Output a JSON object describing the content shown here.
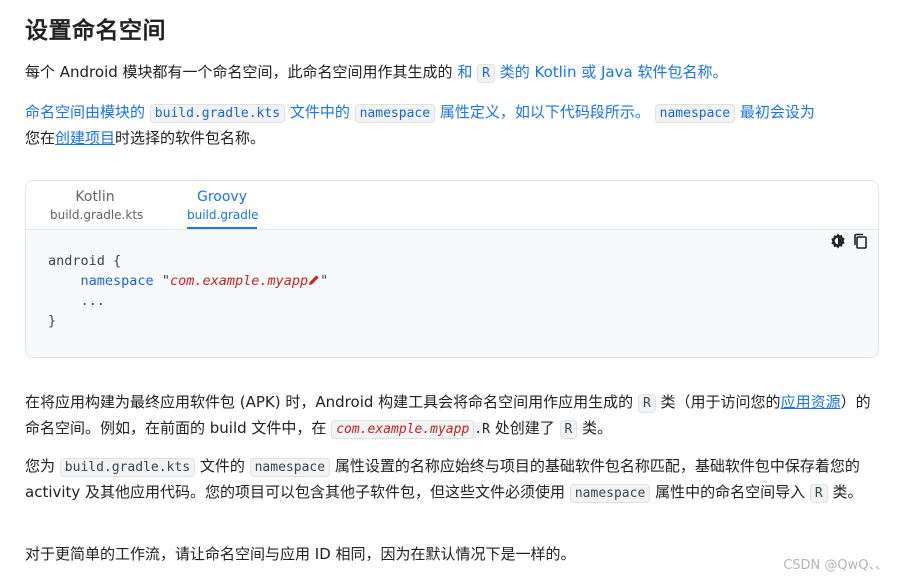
{
  "page": {
    "title": "设置命名空间",
    "p1": {
      "a": "每个 Android 模块都有一个命名空间，此命名空间用作其生成的 ",
      "b": "和",
      "c": "R",
      "d": "类的 Kotlin 或 Java 软件包名称。"
    },
    "p2": {
      "a": "命名空间由模块的",
      "b": "build.gradle.kts",
      "c": "文件中的",
      "d": "namespace",
      "e": "属性定义，如以下代码段所示。",
      "f": "namespace",
      "g": "最初会设为",
      "h": "您在",
      "link": "创建项目",
      "i": "时选择的软件包名称。"
    },
    "code_tabs": [
      {
        "label": "Kotlin",
        "sub": "build.gradle.kts"
      },
      {
        "label": "Groovy",
        "sub": "build.gradle"
      }
    ],
    "code": {
      "line1": "android {",
      "line2_key": "namespace",
      "line2_q1": "\"",
      "line2_val": "com.example.myapp",
      "line2_q2": "\"",
      "line3": "...",
      "line4": "}"
    },
    "p3": {
      "a": "在将应用构建为最终应用软件包 (APK) 时，Android 构建工具会将命名空间用作应用生成的",
      "b": "R",
      "c": "类（用于访问您的",
      "link": "应用资源",
      "d": "）的命名空间。例如，在前面的 build 文件中，在",
      "e": "com.example.myapp",
      "e2": ".R",
      "f": "处创建了",
      "g": "R",
      "h": "类。"
    },
    "p4": {
      "a": "您为",
      "b": "build.gradle.kts",
      "c": "文件的",
      "d": "namespace",
      "e": "属性设置的名称应始终与项目的基础软件包名称匹配，基础软件包中保存着您的 activity 及其他应用代码。您的项目可以包含其他子软件包，但这些文件必须使用",
      "f": "namespace",
      "g": "属性中的命名空间导入",
      "h": "R",
      "i": "类。"
    },
    "p5": "对于更简单的工作流，请让命名空间与应用 ID 相同，因为在默认情况下是一样的。",
    "watermark": "CSDN @QwQ、、"
  },
  "icons": [
    "theme-toggle-icon",
    "copy-icon",
    "pencil-icon"
  ]
}
